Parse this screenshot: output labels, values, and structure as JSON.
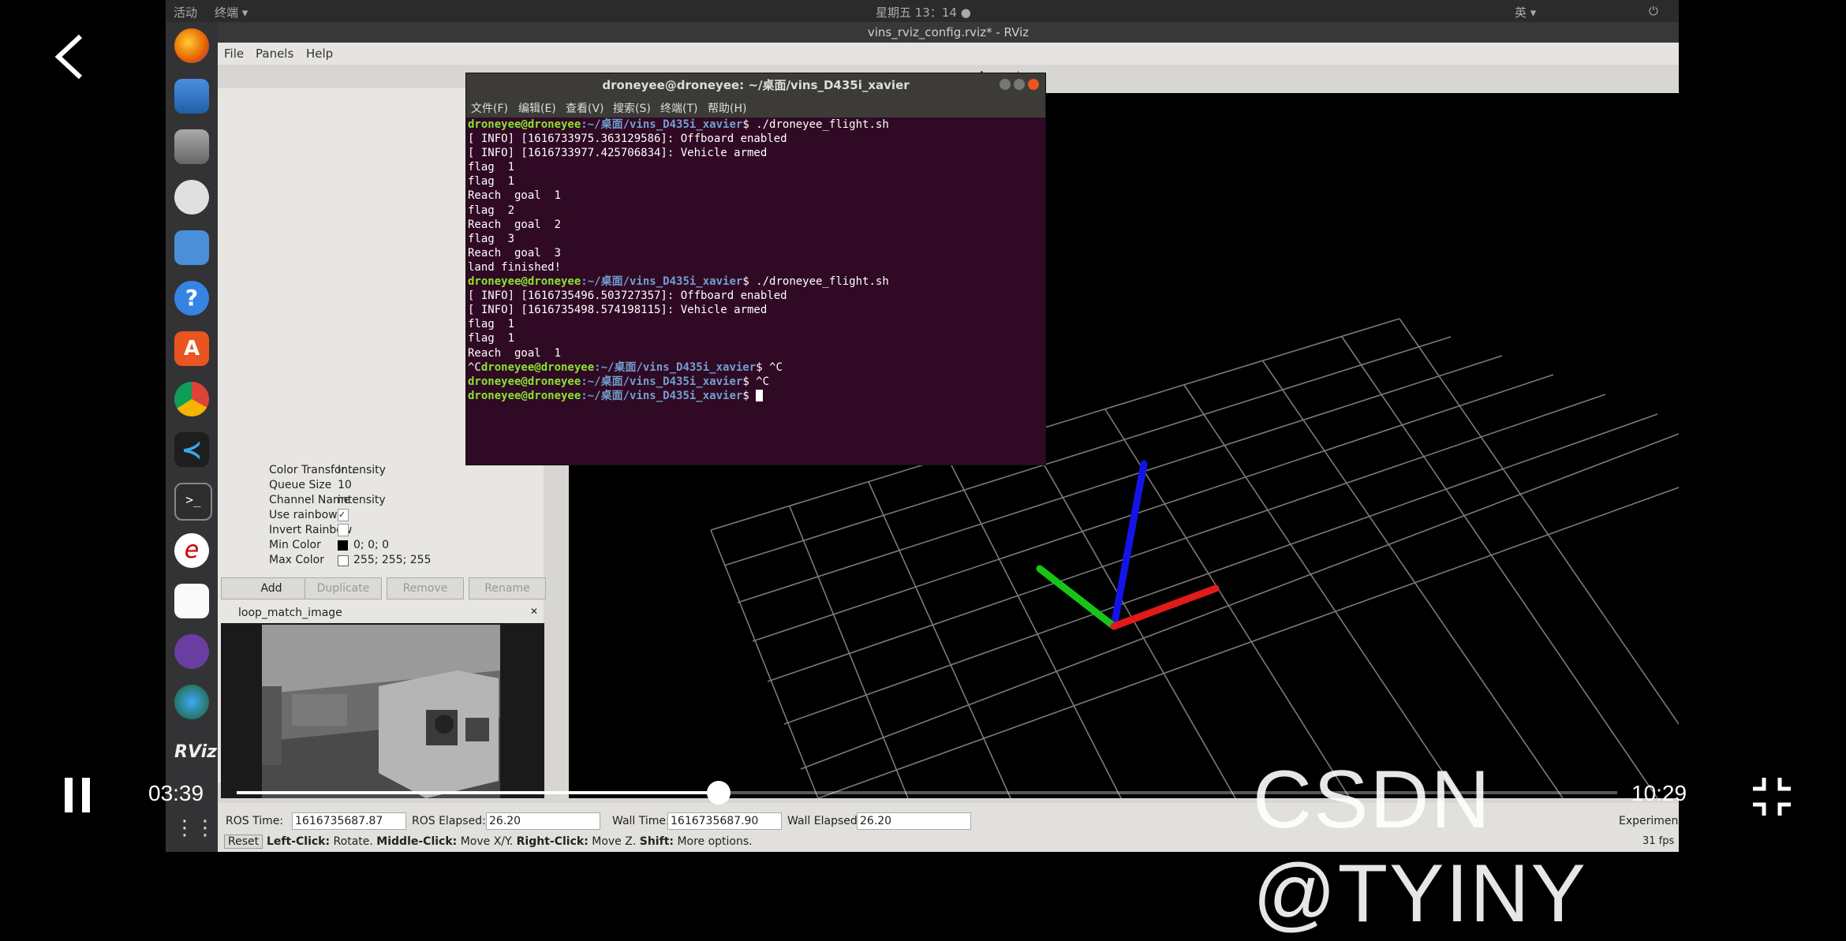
{
  "topbar": {
    "activities": "活动",
    "terminal_menu": "终端 ▾",
    "clock": "星期五 13：14 ●",
    "window_title": "vins_rviz_config.rviz* - RViz",
    "lang": "英 ▾"
  },
  "rviz": {
    "menu": {
      "file": "File",
      "panels": "Panels",
      "help": "Help"
    },
    "properties": [
      {
        "name": "Color Transfor...",
        "value": "Intensity"
      },
      {
        "name": "Queue Size",
        "value": "10"
      },
      {
        "name": "Channel Name",
        "value": "intensity"
      },
      {
        "name": "Use rainbow",
        "value": "✓"
      },
      {
        "name": "Invert Rainbow",
        "value": ""
      },
      {
        "name": "Min Color",
        "value": "0; 0; 0"
      },
      {
        "name": "Max Color",
        "value": "255; 255; 255"
      }
    ],
    "buttons": {
      "add": "Add",
      "duplicate": "Duplicate",
      "remove": "Remove",
      "rename": "Rename"
    },
    "image_panel_title": "loop_match_image",
    "time": {
      "ros_time_label": "ROS Time:",
      "ros_time": "1616735687.87",
      "ros_elapsed_label": "ROS Elapsed:",
      "ros_elapsed": "26.20",
      "wall_time_label": "Wall Time:",
      "wall_time": "1616735687.90",
      "wall_elapsed_label": "Wall Elapsed:",
      "wall_elapsed": "26.20",
      "experimental": "Experimental"
    },
    "reset": "Reset",
    "hint_left": "Left-Click:",
    "hint_left_text": "Rotate.",
    "hint_middle": "Middle-Click:",
    "hint_middle_text": "Move X/Y.",
    "hint_right": "Right-Click:",
    "hint_right_text": "Move Z.",
    "hint_shift": "Shift:",
    "hint_shift_text": "More options.",
    "fps": "31 fps"
  },
  "terminal": {
    "title": "droneyee@droneyee: ~/桌面/vins_D435i_xavier",
    "menu": [
      "文件(F)",
      "编辑(E)",
      "查看(V)",
      "搜索(S)",
      "终端(T)",
      "帮助(H)"
    ],
    "prompt_user": "droneyee@droneyee",
    "prompt_path": ":~/桌面/vins_D435i_xavier",
    "cmd": "$ ./droneyee_flight.sh",
    "lines": {
      "info1": "[ INFO] [1616733975.363129586]: Offboard enabled",
      "info2": "[ INFO] [1616733977.425706834]: Vehicle armed",
      "flag1": "flag  1",
      "reach1": "Reach  goal  1",
      "flag2": "flag  2",
      "reach2": "Reach  goal  2",
      "flag3": "flag  3",
      "reach3": "Reach  goal  3",
      "land": "land finished!",
      "info3": "[ INFO] [1616735496.503727357]: Offboard enabled",
      "info4": "[ INFO] [1616735498.574198115]: Vehicle armed",
      "ctrlc_prefix": "^C",
      "ctrlc_suffix": "$ ^C",
      "last_suffix": "$ "
    }
  },
  "player": {
    "elapsed": "03:39",
    "duration": "10:29",
    "progress": 0.3493,
    "watermark": "CSDN @TYINY"
  }
}
